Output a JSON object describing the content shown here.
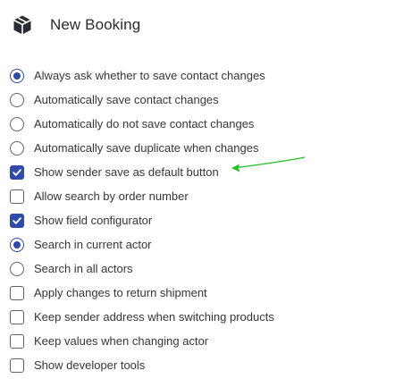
{
  "header": {
    "title": "New Booking",
    "icon": "package-box-icon"
  },
  "colors": {
    "accent": "#2f4aa8",
    "annotation": "#22c02a"
  },
  "options": [
    {
      "type": "radio",
      "checked": true,
      "label": "Always ask whether to save contact changes"
    },
    {
      "type": "radio",
      "checked": false,
      "label": "Automatically save contact changes"
    },
    {
      "type": "radio",
      "checked": false,
      "label": "Automatically do not save contact changes"
    },
    {
      "type": "radio",
      "checked": false,
      "label": "Automatically save duplicate when changes"
    },
    {
      "type": "checkbox",
      "checked": true,
      "label": "Show sender save as default button"
    },
    {
      "type": "checkbox",
      "checked": false,
      "label": "Allow search by order number"
    },
    {
      "type": "checkbox",
      "checked": true,
      "label": "Show field configurator"
    },
    {
      "type": "radio",
      "checked": true,
      "label": "Search in current actor"
    },
    {
      "type": "radio",
      "checked": false,
      "label": "Search in all actors"
    },
    {
      "type": "checkbox",
      "checked": false,
      "label": "Apply changes to return shipment"
    },
    {
      "type": "checkbox",
      "checked": false,
      "label": "Keep sender address when switching products"
    },
    {
      "type": "checkbox",
      "checked": false,
      "label": "Keep values when changing actor"
    },
    {
      "type": "checkbox",
      "checked": false,
      "label": "Show developer tools"
    }
  ]
}
